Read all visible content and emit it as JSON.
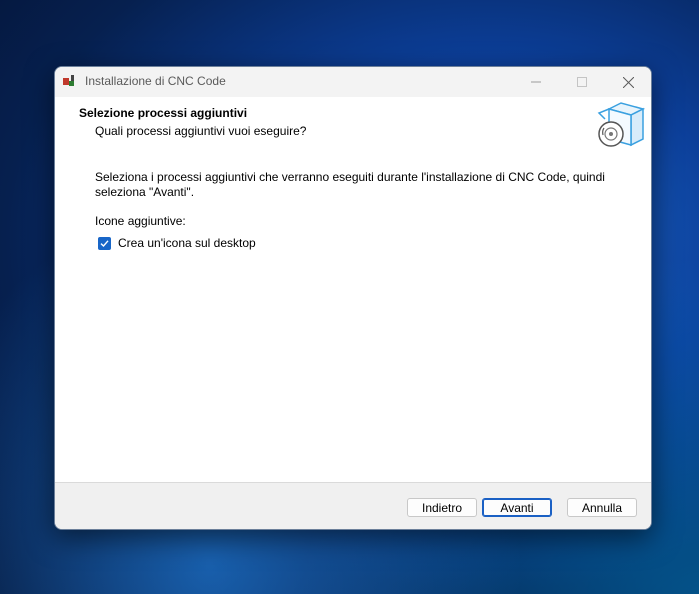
{
  "window": {
    "title": "Installazione di CNC Code",
    "controls": {
      "minimize_icon": "minimize-icon",
      "maximize_icon": "maximize-icon",
      "close_icon": "close-icon"
    }
  },
  "header": {
    "title": "Selezione processi aggiuntivi",
    "subtitle": "Quali processi aggiuntivi vuoi eseguire?",
    "image_icon": "setup-box-disc-icon"
  },
  "content": {
    "description": "Seleziona i processi aggiuntivi che verranno eseguiti durante l'installazione di CNC Code, quindi seleziona \"Avanti\".",
    "group_label": "Icone aggiuntive:",
    "tasks": [
      {
        "label": "Crea un'icona sul desktop",
        "checked": true
      }
    ]
  },
  "footer": {
    "back_label": "Indietro",
    "next_label": "Avanti",
    "cancel_label": "Annulla"
  },
  "colors": {
    "accent": "#1866c8",
    "window_bg": "#ffffff",
    "footer_bg": "#f0f0f0"
  }
}
